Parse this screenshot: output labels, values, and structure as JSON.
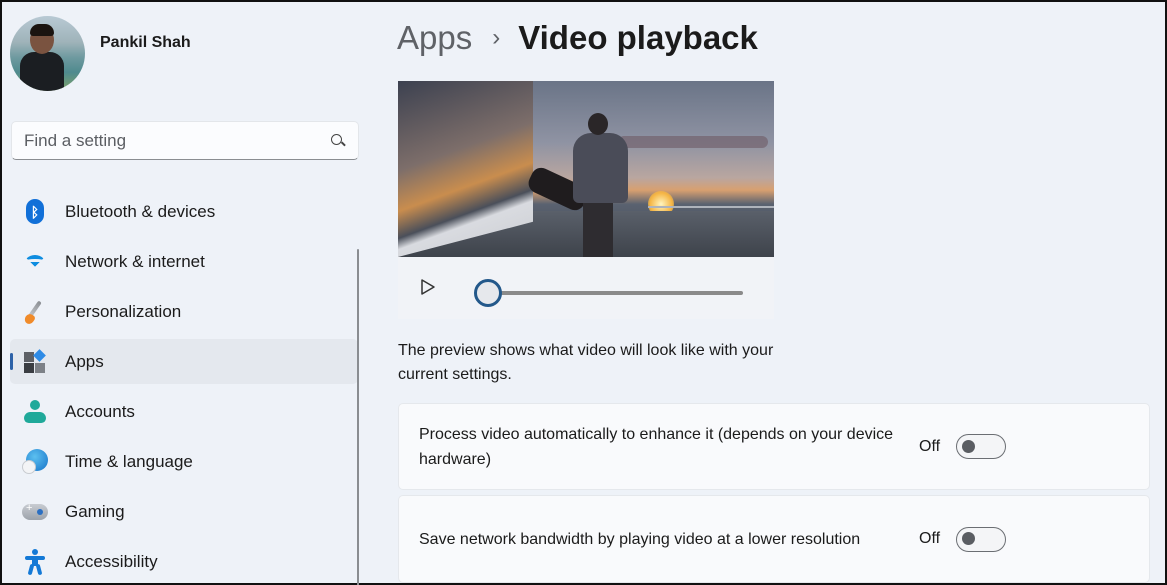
{
  "profile": {
    "name": "Pankil Shah"
  },
  "search": {
    "placeholder": "Find a setting"
  },
  "sidebar": {
    "items": [
      {
        "label": "Bluetooth & devices",
        "icon": "bluetooth-icon",
        "active": false
      },
      {
        "label": "Network & internet",
        "icon": "wifi-icon",
        "active": false
      },
      {
        "label": "Personalization",
        "icon": "paintbrush-icon",
        "active": false
      },
      {
        "label": "Apps",
        "icon": "apps-icon",
        "active": true
      },
      {
        "label": "Accounts",
        "icon": "person-icon",
        "active": false
      },
      {
        "label": "Time & language",
        "icon": "globe-clock-icon",
        "active": false
      },
      {
        "label": "Gaming",
        "icon": "gamepad-icon",
        "active": false
      },
      {
        "label": "Accessibility",
        "icon": "accessibility-icon",
        "active": false
      }
    ]
  },
  "breadcrumb": {
    "parent": "Apps",
    "separator": "›",
    "current": "Video playback"
  },
  "player": {
    "play_icon": "play-icon",
    "progress_percent": 0
  },
  "preview_description": "The preview shows what video will look like with your current settings.",
  "settings": [
    {
      "label": "Process video automatically to enhance it (depends on your device hardware)",
      "state_label": "Off",
      "enabled": false
    },
    {
      "label": "Save network bandwidth by playing video at a lower resolution",
      "state_label": "Off",
      "enabled": false
    }
  ],
  "colors": {
    "accent": "#2d62a8",
    "background": "#eef2f8",
    "card": "#f9fafc"
  }
}
